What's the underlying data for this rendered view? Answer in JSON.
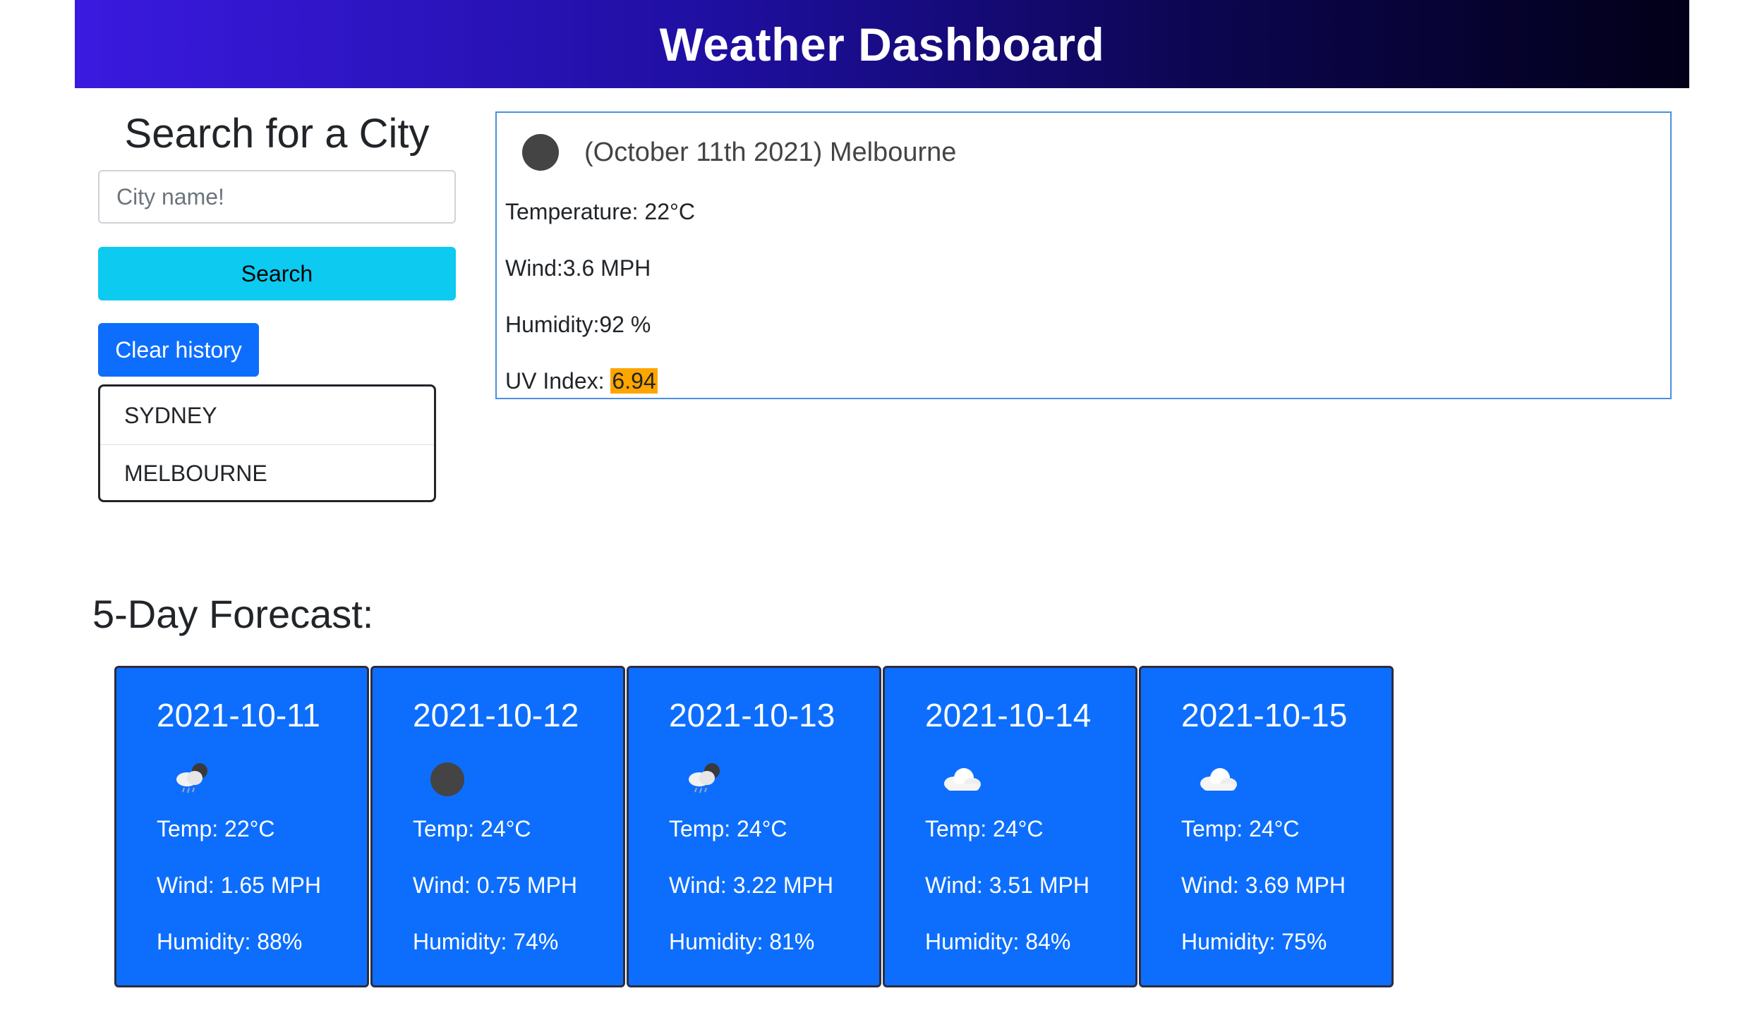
{
  "header": {
    "title": "Weather Dashboard"
  },
  "search": {
    "title": "Search for a City",
    "placeholder": "City name!",
    "button_label": "Search",
    "clear_label": "Clear history"
  },
  "history": {
    "items": [
      {
        "label": "SYDNEY"
      },
      {
        "label": "MELBOURNE"
      }
    ]
  },
  "current": {
    "icon": "dark-circle-icon",
    "title": "(October 11th 2021) Melbourne",
    "temperature": "Temperature: 22°C",
    "wind": "Wind:3.6 MPH",
    "humidity": "Humidity:92 %",
    "uv_label": "UV Index: ",
    "uv_value": "6.94",
    "uv_color": "#ffa500"
  },
  "forecast": {
    "title": "5-Day Forecast:",
    "card_color": "#0d6efd",
    "days": [
      {
        "date": "2021-10-11",
        "icon": "rain-cloud-night-icon",
        "temp": "Temp: 22°C",
        "wind": "Wind: 1.65 MPH",
        "humidity": "Humidity: 88%"
      },
      {
        "date": "2021-10-12",
        "icon": "dark-circle-icon",
        "temp": "Temp: 24°C",
        "wind": "Wind: 0.75 MPH",
        "humidity": "Humidity: 74%"
      },
      {
        "date": "2021-10-13",
        "icon": "rain-cloud-night-icon",
        "temp": "Temp: 24°C",
        "wind": "Wind: 3.22 MPH",
        "humidity": "Humidity: 81%"
      },
      {
        "date": "2021-10-14",
        "icon": "cloud-icon",
        "temp": "Temp: 24°C",
        "wind": "Wind: 3.51 MPH",
        "humidity": "Humidity: 84%"
      },
      {
        "date": "2021-10-15",
        "icon": "cloud-icon",
        "temp": "Temp: 24°C",
        "wind": "Wind: 3.69 MPH",
        "humidity": "Humidity: 75%"
      }
    ]
  }
}
